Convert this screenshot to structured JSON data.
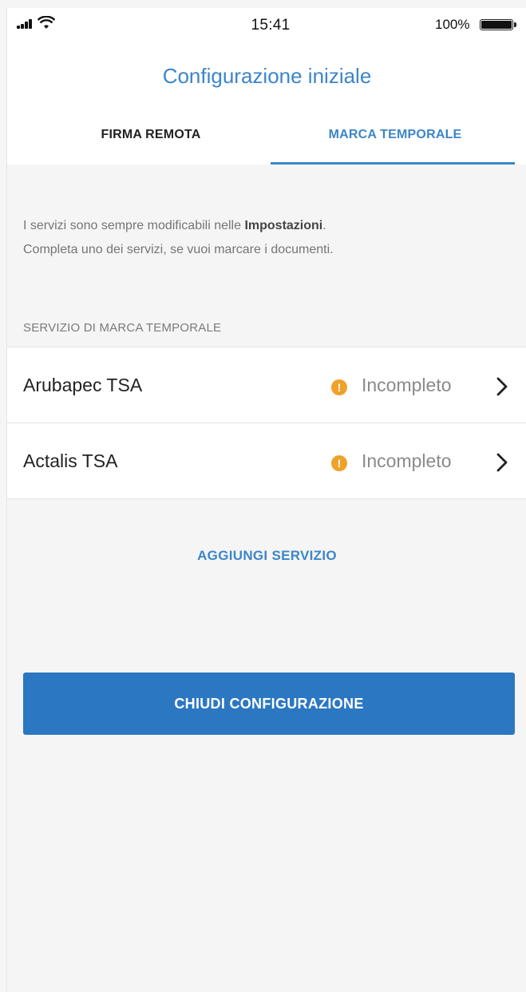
{
  "status_bar": {
    "time": "15:41",
    "battery_percent": "100%",
    "battery_level": 1.0,
    "icons": [
      "signal-icon",
      "wifi-icon",
      "battery-icon"
    ]
  },
  "header": {
    "title": "Configurazione iniziale"
  },
  "tabs": [
    {
      "label": "FIRMA REMOTA",
      "active": false
    },
    {
      "label": "MARCA TEMPORALE",
      "active": true
    }
  ],
  "info": {
    "text_before": "I servizi sono sempre modificabili nelle ",
    "bold": "Impostazioni",
    "text_after": ".",
    "line2": "Completa uno dei servizi, se vuoi marcare i documenti."
  },
  "section": {
    "label": "SERVIZIO DI MARCA TEMPORALE"
  },
  "services": [
    {
      "name": "Arubapec TSA",
      "status": "Incompleto",
      "status_icon": "warning-icon"
    },
    {
      "name": "Actalis TSA",
      "status": "Incompleto",
      "status_icon": "warning-icon"
    }
  ],
  "actions": {
    "add_service": "AGGIUNGI SERVIZIO",
    "close_config": "CHIUDI CONFIGURAZIONE"
  },
  "colors": {
    "accent": "#3c86c8",
    "button": "#2b77c2",
    "warning": "#f0a12b",
    "background": "#f5f5f5"
  }
}
